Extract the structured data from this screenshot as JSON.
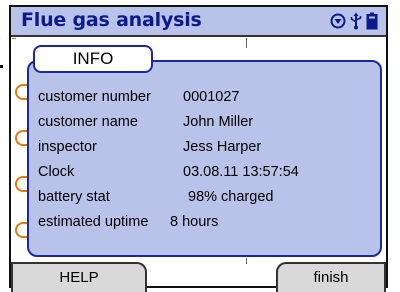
{
  "header": {
    "title": "Flue gas analysis",
    "icons": [
      "down-arrow-circle-icon",
      "usb-icon",
      "battery-icon"
    ]
  },
  "dialog": {
    "tab_label": "INFO",
    "rows": [
      {
        "label": "customer number",
        "value": "0001027"
      },
      {
        "label": "customer name",
        "value": "John Miller"
      },
      {
        "label": "inspector",
        "value": "Jess Harper"
      },
      {
        "label": "Clock",
        "value": "03.08.11 13:57:54"
      },
      {
        "label": "battery stat",
        "value": "98% charged"
      },
      {
        "label": "estimated uptime",
        "value": "8 hours"
      }
    ]
  },
  "softkeys": {
    "left_label": "HELP",
    "right_label": "finish"
  },
  "colors": {
    "panel_fill": "#b9c3ea",
    "title_text": "#0c1a8c",
    "dialog_border": "#1a2a9c",
    "marker_orange": "#e07a10"
  }
}
